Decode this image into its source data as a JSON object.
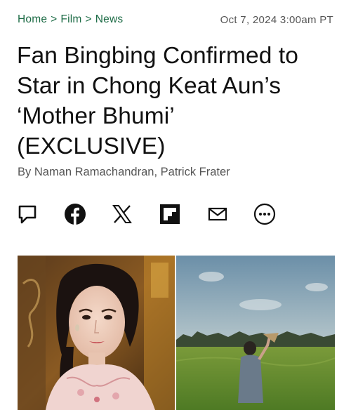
{
  "breadcrumb": {
    "home": "Home",
    "film": "Film",
    "news": "News",
    "separator": ">"
  },
  "article": {
    "date": "Oct 7, 2024 3:00am PT",
    "headline_lines": [
      "Fan Bingbing Confirmed to",
      "Star in Chong Keat Aun’s",
      "‘Mother Bhumi’",
      "(EXCLUSIVE)"
    ],
    "byline_prefix": "By",
    "author1": "Naman Ramachandran",
    "author_sep": ",",
    "author2": "Patrick Frater"
  },
  "share_icons": [
    "comment-icon",
    "facebook-icon",
    "x-icon",
    "flipboard-icon",
    "email-icon",
    "more-icon"
  ],
  "colors": {
    "accent_green": "#1c6b45",
    "text": "#111111",
    "muted": "#555555"
  }
}
